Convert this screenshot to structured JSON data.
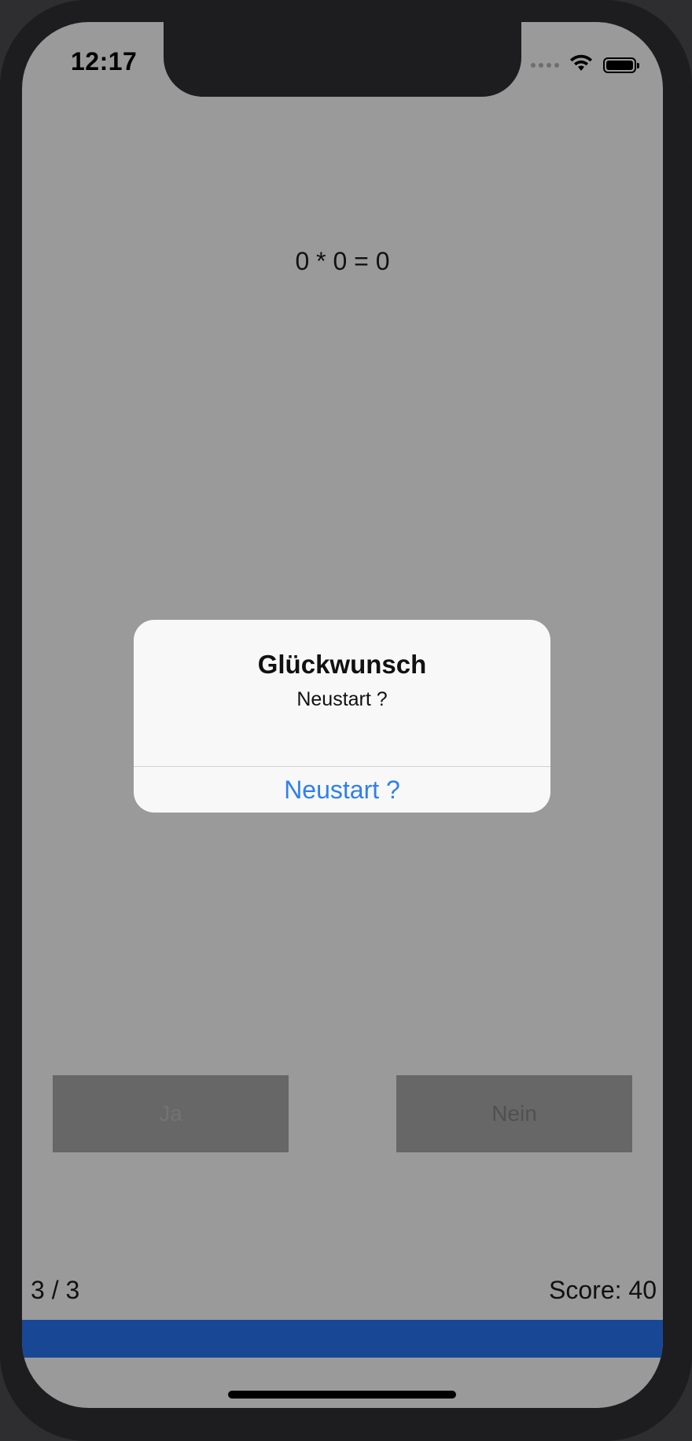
{
  "status_bar": {
    "time": "12:17",
    "icons": [
      "signal-dots-icon",
      "wifi-icon",
      "battery-icon"
    ]
  },
  "quiz": {
    "equation": "0 * 0 = 0",
    "yes_label": "Ja",
    "no_label": "Nein",
    "progress_text": "3 / 3",
    "score_text": "Score: 40",
    "progress_fraction": 1.0
  },
  "dialog": {
    "title": "Glückwunsch",
    "message": "Neustart ?",
    "action_label": "Neustart ?"
  },
  "colors": {
    "accent": "#2f80ed",
    "progress": "#184795",
    "overlay": "#9a9a9a"
  }
}
